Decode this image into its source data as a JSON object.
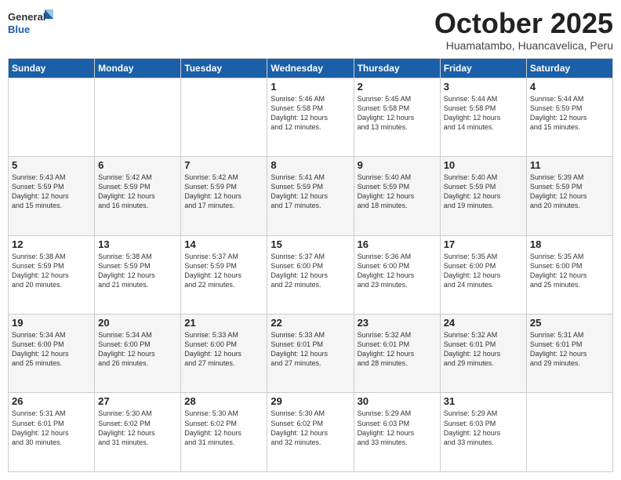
{
  "header": {
    "logo_general": "General",
    "logo_blue": "Blue",
    "month": "October 2025",
    "location": "Huamatambo, Huancavelica, Peru"
  },
  "weekdays": [
    "Sunday",
    "Monday",
    "Tuesday",
    "Wednesday",
    "Thursday",
    "Friday",
    "Saturday"
  ],
  "weeks": [
    [
      {
        "day": "",
        "info": ""
      },
      {
        "day": "",
        "info": ""
      },
      {
        "day": "",
        "info": ""
      },
      {
        "day": "1",
        "info": "Sunrise: 5:46 AM\nSunset: 5:58 PM\nDaylight: 12 hours\nand 12 minutes."
      },
      {
        "day": "2",
        "info": "Sunrise: 5:45 AM\nSunset: 5:58 PM\nDaylight: 12 hours\nand 13 minutes."
      },
      {
        "day": "3",
        "info": "Sunrise: 5:44 AM\nSunset: 5:58 PM\nDaylight: 12 hours\nand 14 minutes."
      },
      {
        "day": "4",
        "info": "Sunrise: 5:44 AM\nSunset: 5:59 PM\nDaylight: 12 hours\nand 15 minutes."
      }
    ],
    [
      {
        "day": "5",
        "info": "Sunrise: 5:43 AM\nSunset: 5:59 PM\nDaylight: 12 hours\nand 15 minutes."
      },
      {
        "day": "6",
        "info": "Sunrise: 5:42 AM\nSunset: 5:59 PM\nDaylight: 12 hours\nand 16 minutes."
      },
      {
        "day": "7",
        "info": "Sunrise: 5:42 AM\nSunset: 5:59 PM\nDaylight: 12 hours\nand 17 minutes."
      },
      {
        "day": "8",
        "info": "Sunrise: 5:41 AM\nSunset: 5:59 PM\nDaylight: 12 hours\nand 17 minutes."
      },
      {
        "day": "9",
        "info": "Sunrise: 5:40 AM\nSunset: 5:59 PM\nDaylight: 12 hours\nand 18 minutes."
      },
      {
        "day": "10",
        "info": "Sunrise: 5:40 AM\nSunset: 5:59 PM\nDaylight: 12 hours\nand 19 minutes."
      },
      {
        "day": "11",
        "info": "Sunrise: 5:39 AM\nSunset: 5:59 PM\nDaylight: 12 hours\nand 20 minutes."
      }
    ],
    [
      {
        "day": "12",
        "info": "Sunrise: 5:38 AM\nSunset: 5:59 PM\nDaylight: 12 hours\nand 20 minutes."
      },
      {
        "day": "13",
        "info": "Sunrise: 5:38 AM\nSunset: 5:59 PM\nDaylight: 12 hours\nand 21 minutes."
      },
      {
        "day": "14",
        "info": "Sunrise: 5:37 AM\nSunset: 5:59 PM\nDaylight: 12 hours\nand 22 minutes."
      },
      {
        "day": "15",
        "info": "Sunrise: 5:37 AM\nSunset: 6:00 PM\nDaylight: 12 hours\nand 22 minutes."
      },
      {
        "day": "16",
        "info": "Sunrise: 5:36 AM\nSunset: 6:00 PM\nDaylight: 12 hours\nand 23 minutes."
      },
      {
        "day": "17",
        "info": "Sunrise: 5:35 AM\nSunset: 6:00 PM\nDaylight: 12 hours\nand 24 minutes."
      },
      {
        "day": "18",
        "info": "Sunrise: 5:35 AM\nSunset: 6:00 PM\nDaylight: 12 hours\nand 25 minutes."
      }
    ],
    [
      {
        "day": "19",
        "info": "Sunrise: 5:34 AM\nSunset: 6:00 PM\nDaylight: 12 hours\nand 25 minutes."
      },
      {
        "day": "20",
        "info": "Sunrise: 5:34 AM\nSunset: 6:00 PM\nDaylight: 12 hours\nand 26 minutes."
      },
      {
        "day": "21",
        "info": "Sunrise: 5:33 AM\nSunset: 6:00 PM\nDaylight: 12 hours\nand 27 minutes."
      },
      {
        "day": "22",
        "info": "Sunrise: 5:33 AM\nSunset: 6:01 PM\nDaylight: 12 hours\nand 27 minutes."
      },
      {
        "day": "23",
        "info": "Sunrise: 5:32 AM\nSunset: 6:01 PM\nDaylight: 12 hours\nand 28 minutes."
      },
      {
        "day": "24",
        "info": "Sunrise: 5:32 AM\nSunset: 6:01 PM\nDaylight: 12 hours\nand 29 minutes."
      },
      {
        "day": "25",
        "info": "Sunrise: 5:31 AM\nSunset: 6:01 PM\nDaylight: 12 hours\nand 29 minutes."
      }
    ],
    [
      {
        "day": "26",
        "info": "Sunrise: 5:31 AM\nSunset: 6:01 PM\nDaylight: 12 hours\nand 30 minutes."
      },
      {
        "day": "27",
        "info": "Sunrise: 5:30 AM\nSunset: 6:02 PM\nDaylight: 12 hours\nand 31 minutes."
      },
      {
        "day": "28",
        "info": "Sunrise: 5:30 AM\nSunset: 6:02 PM\nDaylight: 12 hours\nand 31 minutes."
      },
      {
        "day": "29",
        "info": "Sunrise: 5:30 AM\nSunset: 6:02 PM\nDaylight: 12 hours\nand 32 minutes."
      },
      {
        "day": "30",
        "info": "Sunrise: 5:29 AM\nSunset: 6:03 PM\nDaylight: 12 hours\nand 33 minutes."
      },
      {
        "day": "31",
        "info": "Sunrise: 5:29 AM\nSunset: 6:03 PM\nDaylight: 12 hours\nand 33 minutes."
      },
      {
        "day": "",
        "info": ""
      }
    ]
  ]
}
